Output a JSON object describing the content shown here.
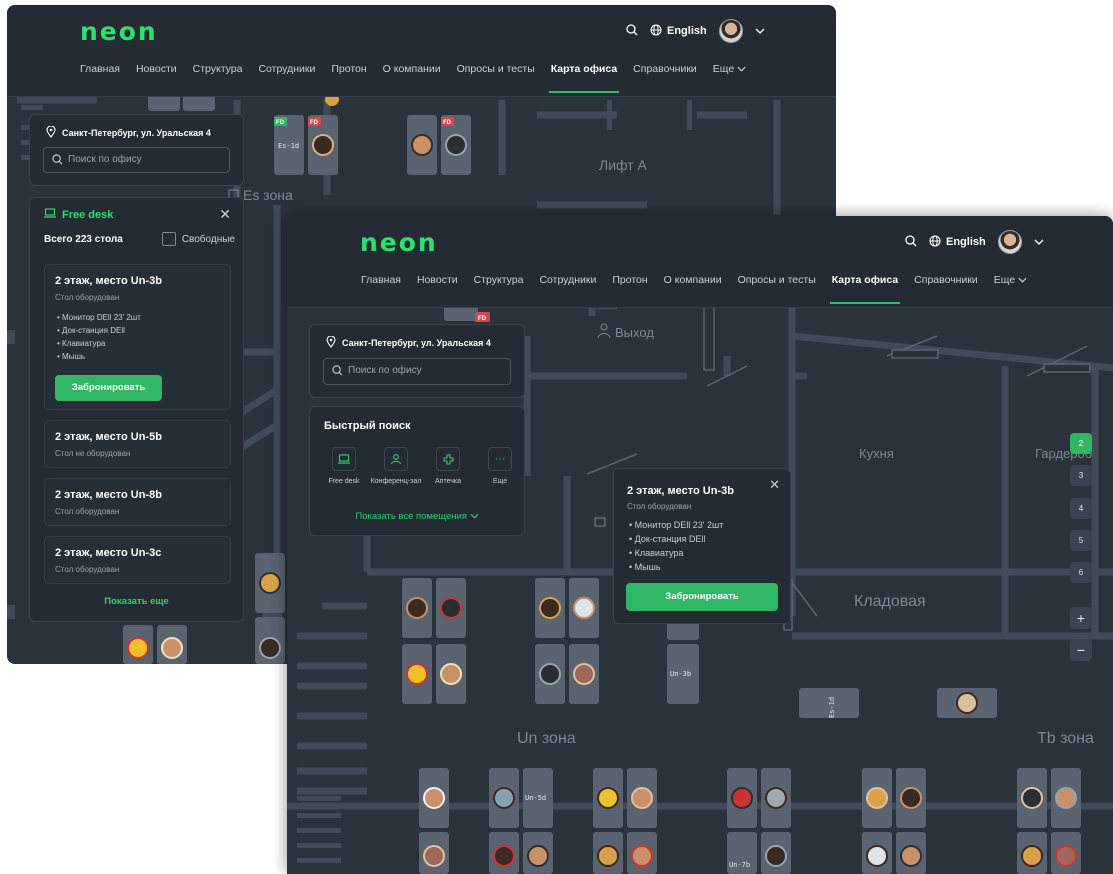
{
  "app": {
    "logo": "neon",
    "search_icon": "search-icon",
    "language": "English",
    "nav": [
      "Главная",
      "Новости",
      "Структура",
      "Сотрудники",
      "Протон",
      "О компании",
      "Опросы и тесты",
      "Карта офиса",
      "Справочники",
      "Еще"
    ],
    "nav_active": "Карта офиса"
  },
  "address": "Санкт-Петербург, ул. Уральская 4",
  "search": {
    "placeholder": "Поиск по офису"
  },
  "free_desk_panel": {
    "title": "Free desk",
    "count": "Всего 223 стола",
    "filter_label": "Свободные",
    "desks": [
      {
        "title": "2 этаж, место Un-3b",
        "status": "Стол оборудован",
        "equipment": [
          "Монитор DEll 23' 2шт",
          "Док-станция DEll",
          "Клавиатура",
          "Мышь"
        ],
        "button": "Забронировать"
      },
      {
        "title": "2 этаж, место Un-5b",
        "status": "Стол не оборудован"
      },
      {
        "title": "2 этаж, место Un-8b",
        "status": "Стол оборудован"
      },
      {
        "title": "2 этаж, место Un-3c",
        "status": "Стол оборудован"
      }
    ],
    "show_more": "Показать еще"
  },
  "quick_search": {
    "title": "Быстрый поиск",
    "items": [
      {
        "label": "Free desk",
        "icon": "laptop-icon"
      },
      {
        "label": "Конференц-зал",
        "icon": "people-icon"
      },
      {
        "label": "Аптечка",
        "icon": "first-aid-icon"
      },
      {
        "label": "Еще",
        "icon": "more-icon"
      }
    ],
    "show_all": "Показать все помещения"
  },
  "popup": {
    "title": "2 этаж, место Un-3b",
    "status": "Стол оборудован",
    "equipment": [
      "Монитор DEll 23' 2шт",
      "Док-станция DEll",
      "Клавиатура",
      "Мышь"
    ],
    "button": "Забронировать"
  },
  "floors": [
    "2",
    "3",
    "4",
    "5",
    "6"
  ],
  "active_floor": "2",
  "zoom_in": "+",
  "zoom_out": "−",
  "map_labels": {
    "back": {
      "lift": "Лифт А",
      "es_zone": "Es зона",
      "fd": "FD",
      "es_1d": "Es-1d"
    },
    "front": {
      "exit": "Выход",
      "kitchen": "Кухня",
      "wardrobe": "Гардероб",
      "storage": "Кладовая",
      "un_zone": "Un зона",
      "tb_zone": "Tb зона",
      "fd": "FD",
      "un_3b": "Un-3b",
      "un_5d": "Un-5d",
      "un_7b": "Un-7b",
      "es_1d": "Es-1d"
    }
  },
  "colors": {
    "accent": "#2fb766",
    "logo": "#2fe06b",
    "background": "#2a323c",
    "panel": "#242b34",
    "tag": "#d8434f"
  }
}
